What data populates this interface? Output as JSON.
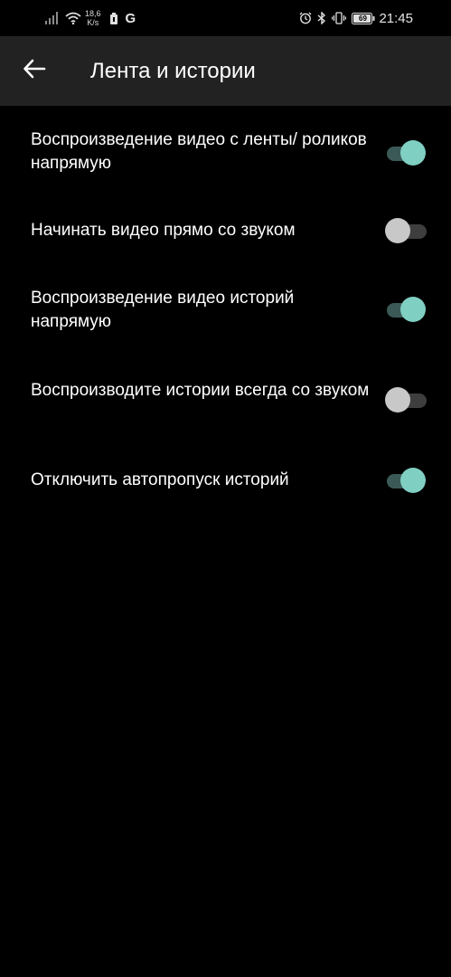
{
  "status_bar": {
    "speed_value": "18,6",
    "speed_unit": "K/s",
    "network_letter": "G",
    "battery_level": "69",
    "time": "21:45"
  },
  "toolbar": {
    "title": "Лента и истории",
    "back_icon": "arrow-left-icon"
  },
  "settings": [
    {
      "label": "Воспроизведение видео с ленты/ роликов напрямую",
      "enabled": true
    },
    {
      "label": "Начинать видео прямо со звуком",
      "enabled": false
    },
    {
      "label": "Воспроизведение видео историй напрямую",
      "enabled": true
    },
    {
      "label": "Воспроизводите истории всегда со звуком",
      "enabled": false
    },
    {
      "label": "Отключить автопропуск историй",
      "enabled": true
    }
  ],
  "colors": {
    "background": "#000000",
    "toolbar": "#222222",
    "toggle_on_thumb": "#7fcfc2",
    "toggle_on_track": "#3b5a57",
    "toggle_off_thumb": "#c8c8c8",
    "toggle_off_track": "#3e3e3e"
  }
}
